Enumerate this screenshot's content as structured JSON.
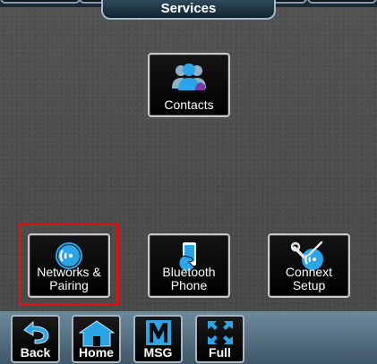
{
  "header": {
    "title": "Services"
  },
  "apps": {
    "contacts": {
      "label": "Contacts"
    },
    "networks": {
      "line1": "Networks &",
      "line2": "Pairing"
    },
    "bluetooth": {
      "line1": "Bluetooth",
      "line2": "Phone"
    },
    "connext": {
      "line1": "Connext",
      "line2": "Setup"
    }
  },
  "nav": {
    "back": "Back",
    "home": "Home",
    "msg": "MSG",
    "full": "Full"
  },
  "colors": {
    "accent": "#2aa6e8",
    "highlight": "#e01010",
    "frame": "#c9c9c9"
  },
  "icons": {
    "contacts": "contacts-people-icon",
    "networks": "wireless-signal-icon",
    "bluetooth": "phone-icon",
    "connext": "wrench-screwdriver-icon",
    "back": "back-arrow-icon",
    "home": "home-icon",
    "msg": "message-m-icon",
    "full": "fullscreen-arrows-icon"
  }
}
